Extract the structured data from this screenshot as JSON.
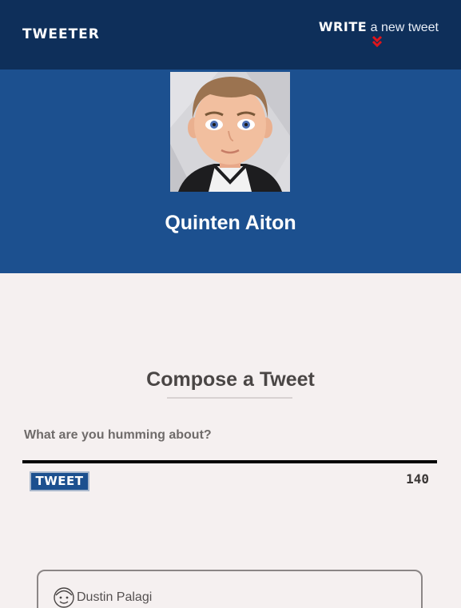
{
  "nav": {
    "brand": "TWEETER",
    "write_strong": "WRITE",
    "write_rest": " a new tweet",
    "chevron_icon": "double-chevron-down-icon",
    "chevron_color": "#e0151b"
  },
  "profile": {
    "name": "Quinten Aiton",
    "avatar_icon": "cartoon-avatar-icon"
  },
  "compose": {
    "title": "Compose a Tweet",
    "placeholder": "What are you humming about?",
    "value": "",
    "button_label": "TWEET",
    "char_count": "140"
  },
  "tweets": [
    {
      "author": "Dustin Palagi",
      "avatar_icon": "sketch-face-icon"
    }
  ],
  "colors": {
    "nav_bg": "#0e2f5a",
    "header_bg": "#1c508f",
    "page_bg": "#f5f0f0",
    "accent": "#e0151b"
  }
}
